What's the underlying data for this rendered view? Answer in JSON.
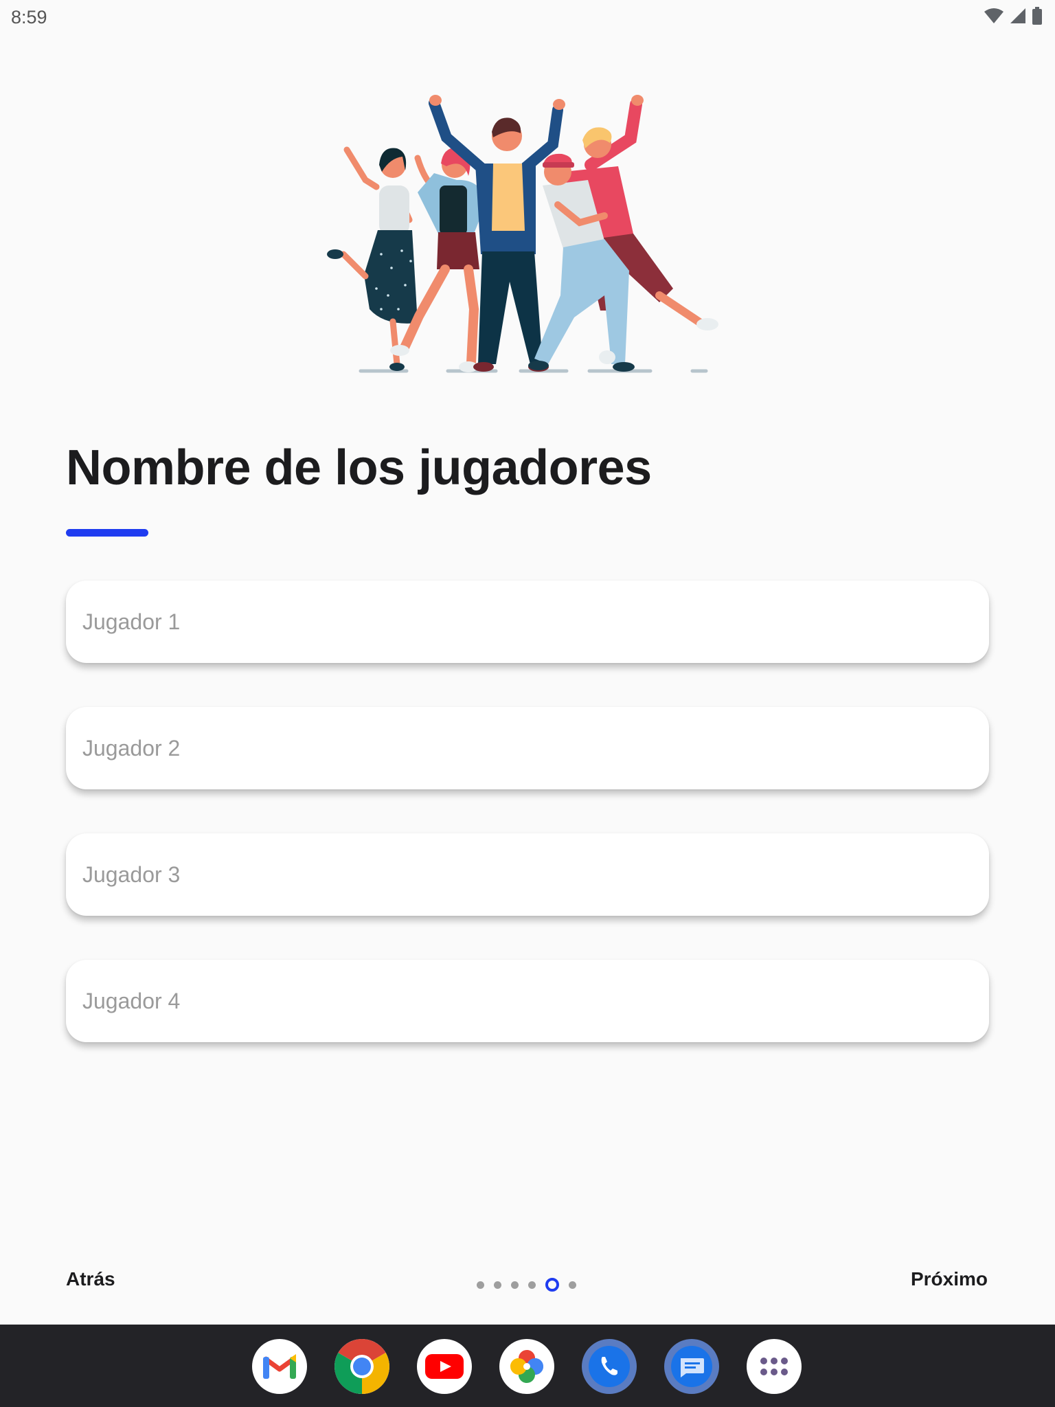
{
  "status_bar": {
    "time": "8:59"
  },
  "page": {
    "title": "Nombre de los jugadores"
  },
  "fields": [
    {
      "placeholder": "Jugador 1"
    },
    {
      "placeholder": "Jugador 2"
    },
    {
      "placeholder": "Jugador 3"
    },
    {
      "placeholder": "Jugador 4"
    }
  ],
  "navigation": {
    "back_label": "Atrás",
    "next_label": "Próximo",
    "page_count": 6,
    "active_page": 5
  },
  "dock": {
    "apps": [
      "gmail-icon",
      "chrome-icon",
      "youtube-icon",
      "photos-icon",
      "phone-icon",
      "messages-icon",
      "app-drawer-icon"
    ]
  },
  "colors": {
    "accent": "#1f3cf0",
    "background": "#fafafa",
    "dock": "#232327"
  }
}
